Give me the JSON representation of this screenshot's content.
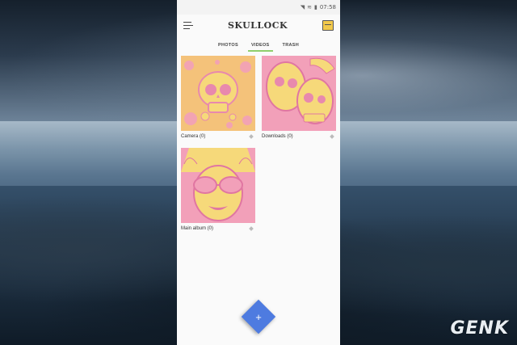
{
  "app": {
    "logo_text": "SKULLOCK",
    "status_time": "07:58",
    "status_battery": "▮"
  },
  "tabs": [
    {
      "label": "PHOTOS",
      "active": false
    },
    {
      "label": "VIDEOS",
      "active": true
    },
    {
      "label": "TRASH",
      "active": false
    }
  ],
  "albums": [
    {
      "label": "Camera (0)"
    },
    {
      "label": "Downloads (0)"
    },
    {
      "label": "Main album (0)"
    }
  ],
  "fab": {
    "label": "+"
  },
  "watermark": "GENK",
  "colors": {
    "accent_tab": "#8fcf6c",
    "fab": "#4e7be0",
    "thumb_pink": "#f2a0b9",
    "thumb_yellow": "#f6d97a"
  },
  "icons": {
    "menu": "hamburger-menu-icon",
    "shop": "shop-icon",
    "add": "plus-icon",
    "album_option": "diamond-icon"
  }
}
